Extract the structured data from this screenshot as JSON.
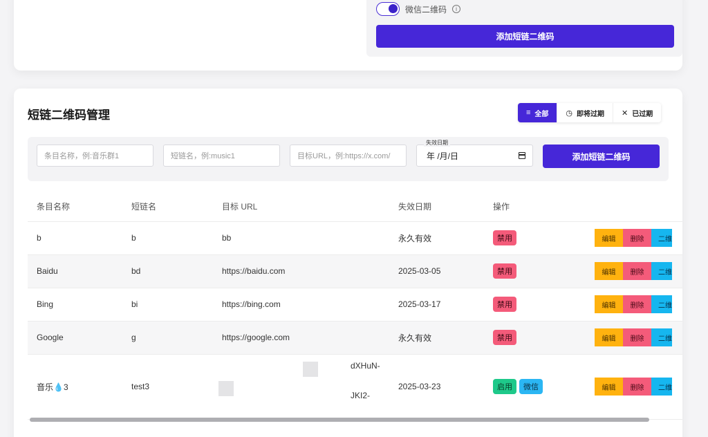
{
  "top": {
    "toggle_label": "微信二维码",
    "toggle_on": true,
    "info_icon": "info-icon",
    "add_button": "添加短链二维码"
  },
  "management": {
    "title": "短链二维码管理",
    "filters": [
      {
        "label": "全部",
        "icon": "list-icon",
        "active": true
      },
      {
        "label": "即将过期",
        "icon": "clock-icon",
        "active": false
      },
      {
        "label": "已过期",
        "icon": "close-icon",
        "active": false
      }
    ],
    "form": {
      "name_placeholder": "条目名称，例:音乐群1",
      "short_placeholder": "短链名，例:music1",
      "url_placeholder": "目标URL，例:https://x.com/",
      "date_label": "失效日期",
      "date_value": "年 /月/日",
      "add_button": "添加短链二维码"
    },
    "table": {
      "headers": [
        "条目名称",
        "短链名",
        "目标 URL",
        "失效日期",
        "操作"
      ],
      "rows": [
        {
          "name": "b",
          "short": "b",
          "url": "bb",
          "expiry": "永久有效",
          "status": "禁用"
        },
        {
          "name": "Baidu",
          "short": "bd",
          "url": "https://baidu.com",
          "expiry": "2025-03-05",
          "status": "禁用"
        },
        {
          "name": "Bing",
          "short": "bi",
          "url": "https://bing.com",
          "expiry": "2025-03-17",
          "status": "禁用"
        },
        {
          "name": "Google",
          "short": "g",
          "url": "https://google.com",
          "expiry": "永久有效",
          "status": "禁用"
        },
        {
          "name": "音乐💧3",
          "short": "test3",
          "url_top": "dXHuN-",
          "url_bottom": "JKI2-",
          "expiry": "2025-03-23",
          "status": "启用",
          "tag": "微信"
        }
      ],
      "actions": {
        "edit": "编辑",
        "delete": "删除",
        "qr": "二维"
      }
    }
  },
  "colors": {
    "primary": "#4627d8",
    "danger": "#f45b7a",
    "warning": "#ffb20f",
    "info": "#16b6ef",
    "success": "#1ec98a"
  }
}
